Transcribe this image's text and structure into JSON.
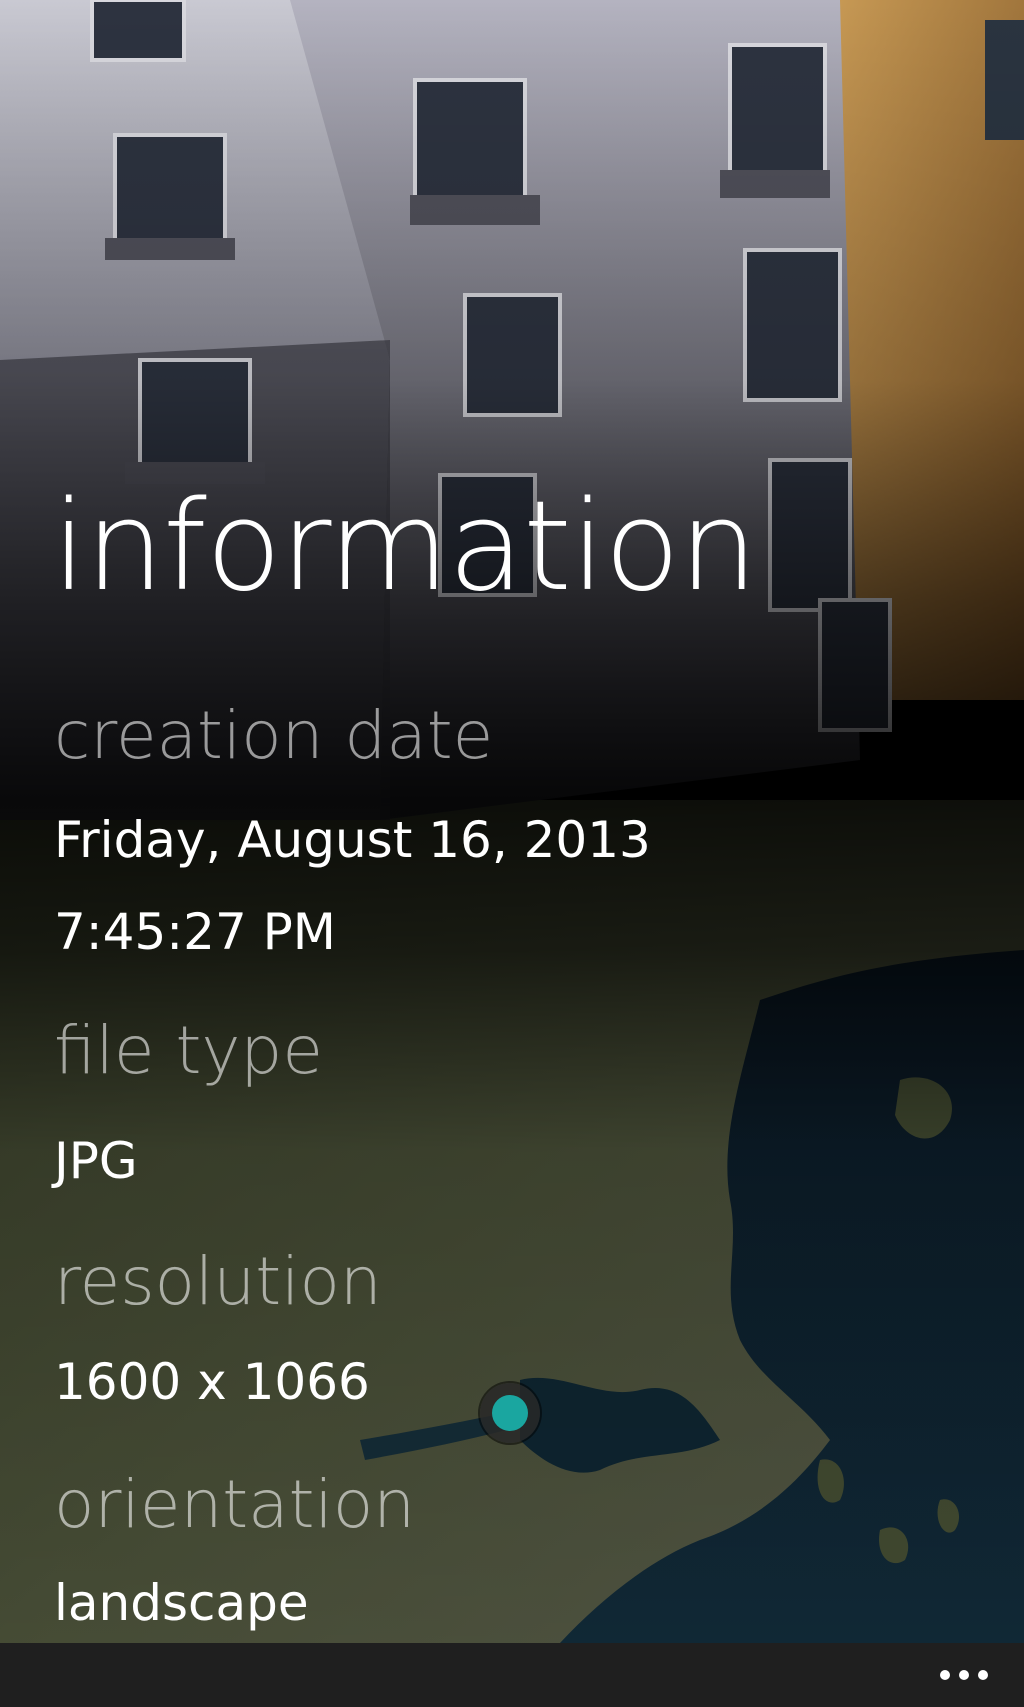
{
  "page": {
    "title": "information"
  },
  "fields": {
    "creation_date": {
      "label": "creation date",
      "date": "Friday, August 16, 2013",
      "time": "7:45:27 PM"
    },
    "file_type": {
      "label": "file type",
      "value": "JPG"
    },
    "resolution": {
      "label": "resolution",
      "value": "1600 x 1066"
    },
    "orientation": {
      "label": "orientation",
      "value": "landscape"
    }
  },
  "map": {
    "pin_icon": "location-pin-icon",
    "pin_color": "#1aa6a0"
  },
  "app_bar": {
    "more_icon": "ellipsis-icon"
  },
  "colors": {
    "accent": "#1aa6a0",
    "app_bar": "#1f1f1f",
    "text": "#ffffff"
  }
}
